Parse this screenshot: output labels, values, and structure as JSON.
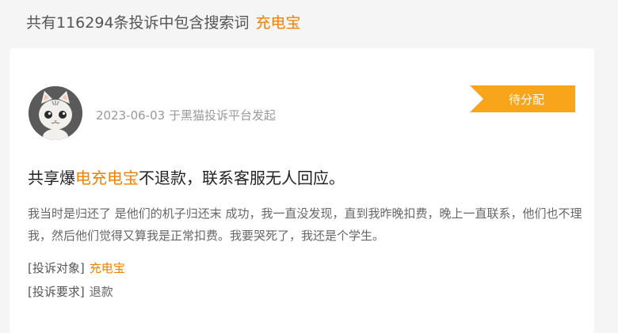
{
  "header": {
    "prefix": "共有116294条投诉中包含搜索词",
    "keyword": "充电宝"
  },
  "complaint": {
    "meta": "2023-06-03 于黑猫投诉平台发起",
    "status": "待分配",
    "title_before": "共享爆",
    "title_highlight": "电充电宝",
    "title_after": "不退款，联系客服无人回应。",
    "body": "我当时是归还了 是他们的机子归还末 成功，我一直没发现，直到我昨晚扣费，晚上一直联系，他们也不理我，然后他们觉得又算我是正常扣费。我要哭死了，我还是个学生。",
    "target_label": "[投诉对象]",
    "target_value": "充电宝",
    "request_label": "[投诉要求]",
    "request_value": "退款"
  },
  "colors": {
    "accent": "#f08000",
    "status_bg": "#f8a51c",
    "avatar_bg": "#5a5a5a"
  },
  "icons": {
    "avatar": "cat-avatar-icon"
  }
}
